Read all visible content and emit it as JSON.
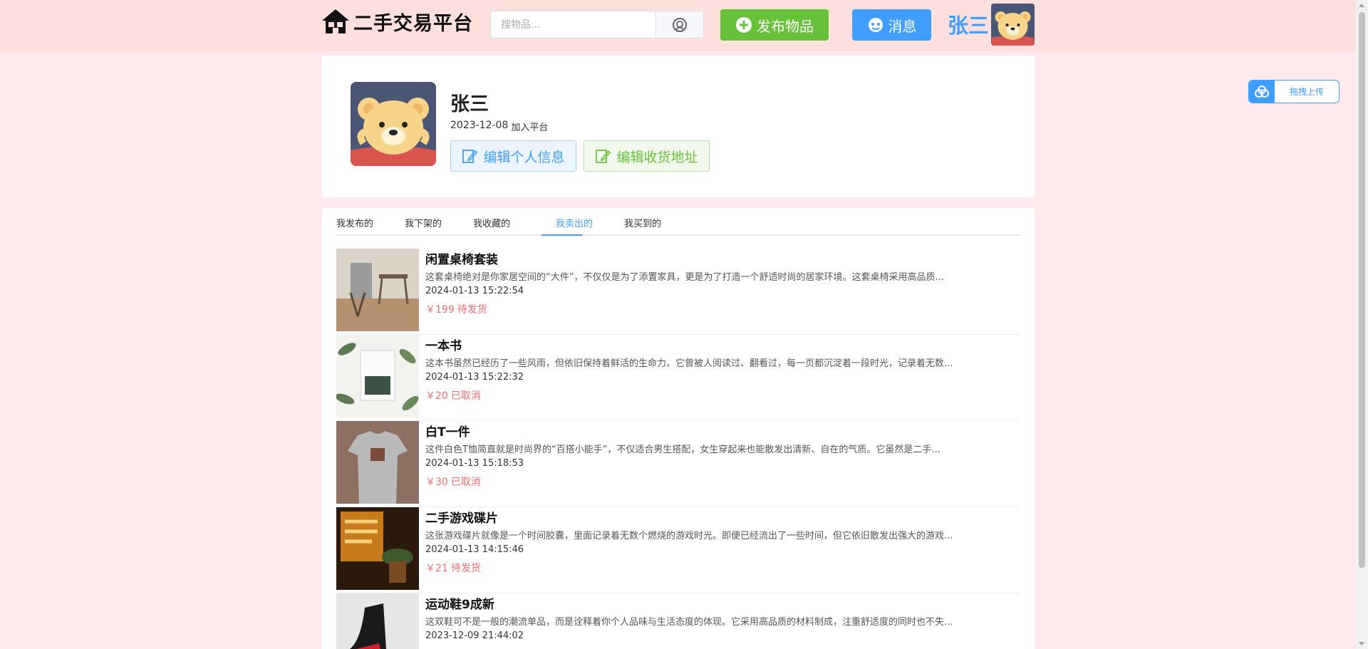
{
  "header": {
    "logo_text": "二手交易平台",
    "search_placeholder": "搜物品...",
    "publish_label": "发布物品",
    "message_label": "消息",
    "username": "张三"
  },
  "profile": {
    "name": "张三",
    "joined_date": "2023-12-08",
    "joined_label": "加入平台",
    "edit_info_label": "编辑个人信息",
    "edit_address_label": "编辑收货地址"
  },
  "tabs": [
    {
      "label": "我发布的",
      "active": false
    },
    {
      "label": "我下架的",
      "active": false
    },
    {
      "label": "我收藏的",
      "active": false
    },
    {
      "label": "我卖出的",
      "active": true
    },
    {
      "label": "我买到的",
      "active": false
    }
  ],
  "items": [
    {
      "title": "闲置桌椅套装",
      "description": "这套桌椅绝对是你家居空间的“大件”，不仅仅是为了添置家具，更是为了打造一个舒适时尚的居家环境。这套桌椅采用高品质...",
      "date": "2024-01-13 15:22:54",
      "price": "￥199",
      "status": "待发货"
    },
    {
      "title": "一本书",
      "description": "这本书虽然已经历了一些风雨，但依旧保持着鲜活的生命力。它曾被人阅读过、翻看过，每一页都沉淀着一段时光，记录着无数...",
      "date": "2024-01-13 15:22:32",
      "price": "￥20",
      "status": "已取消"
    },
    {
      "title": "白T一件",
      "description": "这件白色T恤简直就是时尚界的“百搭小能手”，不仅适合男生搭配，女生穿起来也能散发出清新、自在的气质。它虽然是二手...",
      "date": "2024-01-13 15:18:53",
      "price": "￥30",
      "status": "已取消"
    },
    {
      "title": "二手游戏碟片",
      "description": "这张游戏碟片就像是一个时间胶囊，里面记录着无数个燃烧的游戏时光。即便已经流出了一些时间，但它依旧散发出强大的游戏...",
      "date": "2024-01-13 14:15:46",
      "price": "￥21",
      "status": "待发货"
    },
    {
      "title": "运动鞋9成新",
      "description": "这双鞋可不是一般的潮流单品，而是诠释着你个人品味与生活态度的体现。它采用高品质的材料制成，注重舒适度的同时也不失...",
      "date": "2023-12-09 21:44:02",
      "price": "",
      "status": ""
    }
  ],
  "upload": {
    "label": "拖拽上传"
  },
  "colors": {
    "primary": "#409eff",
    "success": "#67c23a",
    "danger": "#f56c6c",
    "header_bg": "#fde0de",
    "page_bg": "#ffe9ec"
  }
}
